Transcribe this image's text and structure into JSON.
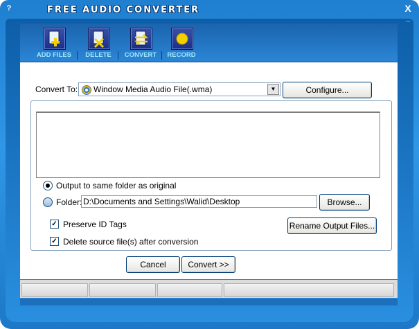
{
  "window": {
    "title": "FREE AUDIO CONVERTER",
    "help_label": "?",
    "close_label": "X",
    "minimize_label": "_"
  },
  "toolbar": {
    "items": [
      {
        "label": "ADD FILES",
        "icon": "add-files-icon"
      },
      {
        "label": "DELETE",
        "icon": "delete-icon"
      },
      {
        "label": "CONVERT",
        "icon": "convert-icon"
      },
      {
        "label": "RECORD",
        "icon": "record-icon"
      }
    ]
  },
  "convert_to": {
    "label": "Convert To:",
    "selected": "Window Media Audio File(.wma)",
    "configure_button": "Configure..."
  },
  "output": {
    "same_folder_label": "Output to same folder as original",
    "folder_label": "Folder:",
    "folder_value": "D:\\Documents and Settings\\Walid\\Desktop",
    "browse_button": "Browse..."
  },
  "options": {
    "preserve_id_tags": "Preserve ID Tags",
    "delete_source": "Delete source file(s) after conversion",
    "rename_button": "Rename Output Files..."
  },
  "actions": {
    "cancel": "Cancel",
    "convert": "Convert >>"
  },
  "colors": {
    "frame": "#2f97e6",
    "toolbar_label": "#9fe7ff"
  }
}
